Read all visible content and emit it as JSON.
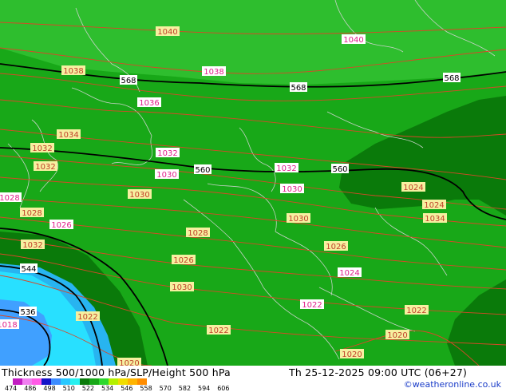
{
  "map": {
    "colors": {
      "bg": "#18a818",
      "north_band": "#2ebe2e",
      "dark_zone": "#0a7a0a",
      "cold_light": "#28e0ff",
      "cold_mid": "#28b4f0",
      "cold_deep": "#40a0ff",
      "pressure_line": "#d84828",
      "height_line": "#000000",
      "border_line": "#c8d2c8"
    },
    "pressure_labels": [
      {
        "text": "1040",
        "style": "yellow"
      },
      {
        "text": "1040",
        "style": "pink"
      },
      {
        "text": "1038",
        "style": "yellow"
      },
      {
        "text": "1038",
        "style": "pink"
      },
      {
        "text": "1036",
        "style": "pink"
      },
      {
        "text": "1034",
        "style": "yellow"
      },
      {
        "text": "1032",
        "style": "yellow"
      },
      {
        "text": "1032",
        "style": "pink"
      },
      {
        "text": "1032",
        "style": "pink"
      },
      {
        "text": "1032",
        "style": "yellow"
      },
      {
        "text": "1030",
        "style": "pink"
      },
      {
        "text": "1030",
        "style": "pink"
      },
      {
        "text": "1030",
        "style": "yellow"
      },
      {
        "text": "1030",
        "style": "yellow"
      },
      {
        "text": "1028",
        "style": "pink"
      },
      {
        "text": "1028",
        "style": "yellow"
      },
      {
        "text": "1028",
        "style": "yellow"
      },
      {
        "text": "1026",
        "style": "pink"
      },
      {
        "text": "1026",
        "style": "yellow"
      },
      {
        "text": "1026",
        "style": "yellow"
      },
      {
        "text": "1024",
        "style": "pink"
      },
      {
        "text": "1024",
        "style": "yellow"
      },
      {
        "text": "1024",
        "style": "yellow"
      },
      {
        "text": "1034",
        "style": "yellow"
      },
      {
        "text": "1032",
        "style": "yellow"
      },
      {
        "text": "1030",
        "style": "yellow"
      },
      {
        "text": "1022",
        "style": "pink"
      },
      {
        "text": "1022",
        "style": "yellow"
      },
      {
        "text": "1022",
        "style": "yellow"
      },
      {
        "text": "1022",
        "style": "yellow"
      },
      {
        "text": "1020",
        "style": "yellow"
      },
      {
        "text": "1020",
        "style": "yellow"
      },
      {
        "text": "1020",
        "style": "yellow"
      },
      {
        "text": "1020",
        "style": "yellow"
      },
      {
        "text": "1018",
        "style": "pink"
      }
    ],
    "height_labels": [
      "568",
      "568",
      "568",
      "560",
      "560",
      "544",
      "536"
    ]
  },
  "footer": {
    "title_left": "Thickness 500/1000 hPa/SLP/Height 500 hPa",
    "title_right": "Th 25-12-2025 09:00 UTC (06+27)",
    "credit": "©weatheronline.co.uk",
    "legend_colors": [
      "#c21cc2",
      "#f07ef0",
      "#ff5ae6",
      "#1414c8",
      "#3c8cff",
      "#28c8ff",
      "#28f0f0",
      "#0a7a0a",
      "#18a818",
      "#2ed82e",
      "#b4f000",
      "#f0dc00",
      "#ffb400",
      "#ff8c00"
    ],
    "legend_ticks": [
      "474",
      "486",
      "498",
      "510",
      "522",
      "534",
      "546",
      "558",
      "570",
      "582",
      "594",
      "606"
    ]
  }
}
